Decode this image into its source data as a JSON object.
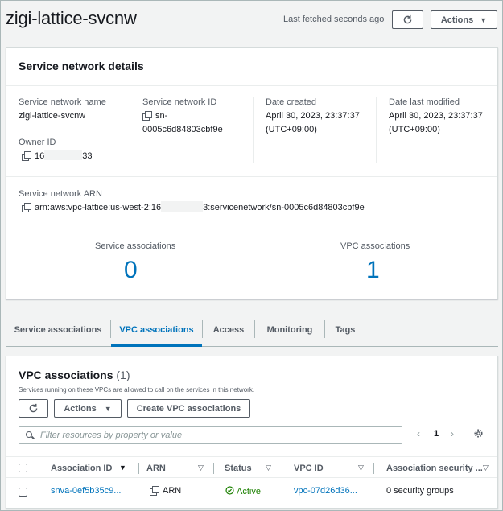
{
  "header": {
    "title": "zigi-lattice-svcnw",
    "last_fetched": "Last fetched seconds ago",
    "actions_label": "Actions"
  },
  "details": {
    "title": "Service network details",
    "name_label": "Service network name",
    "name_value": "zigi-lattice-svcnw",
    "id_label": "Service network ID",
    "id_value_line1": "sn-",
    "id_value_line2": "0005c6d84803cbf9e",
    "created_label": "Date created",
    "created_line1": "April 30, 2023, 23:37:37",
    "created_line2": "(UTC+09:00)",
    "modified_label": "Date last modified",
    "modified_line1": "April 30, 2023, 23:37:37",
    "modified_line2": "(UTC+09:00)",
    "owner_label": "Owner ID",
    "owner_prefix": "16",
    "owner_suffix": "33",
    "arn_label": "Service network ARN",
    "arn_prefix": "arn:aws:vpc-lattice:us-west-2:16",
    "arn_suffix": "3:servicenetwork/sn-0005c6d84803cbf9e"
  },
  "stats": {
    "service_assoc_label": "Service associations",
    "service_assoc_value": "0",
    "vpc_assoc_label": "VPC associations",
    "vpc_assoc_value": "1"
  },
  "tabs": [
    {
      "label": "Service associations"
    },
    {
      "label": "VPC associations"
    },
    {
      "label": "Access"
    },
    {
      "label": "Monitoring"
    },
    {
      "label": "Tags"
    }
  ],
  "vpc_section": {
    "title": "VPC associations",
    "count": "(1)",
    "description": "Services running on these VPCs are allowed to call on the services in this network.",
    "actions_label": "Actions",
    "create_label": "Create VPC associations",
    "search_placeholder": "Filter resources by property or value",
    "page": "1",
    "columns": [
      {
        "label": "Association ID"
      },
      {
        "label": "ARN"
      },
      {
        "label": "Status"
      },
      {
        "label": "VPC ID"
      },
      {
        "label": "Association security ..."
      }
    ],
    "rows": [
      {
        "association_id": "snva-0ef5b35c9...",
        "arn": "ARN",
        "status": "Active",
        "vpc_id": "vpc-07d26d36...",
        "security": "0 security groups"
      }
    ]
  },
  "colors": {
    "accent": "#0073bb",
    "success": "#1d8102",
    "text": "#16191f",
    "muted": "#545b64"
  }
}
